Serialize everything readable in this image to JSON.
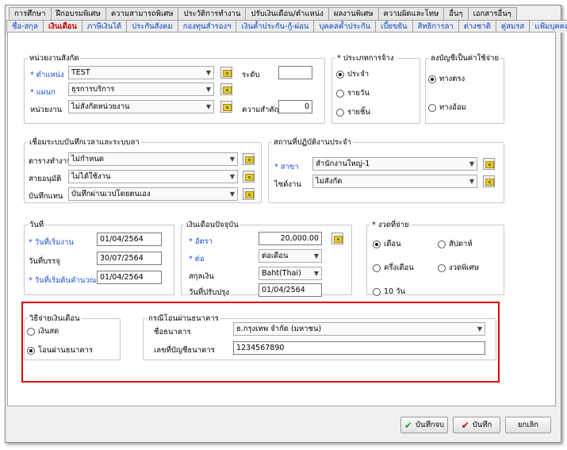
{
  "tabs_row1": [
    "การศึกษา",
    "ฝึกอบรมพิเศษ",
    "ความสามารถพิเศษ",
    "ประวัติการทำงาน",
    "ปรับเงินเดือน/ตำแหน่ง",
    "ผลงานพิเศษ",
    "ความผิดและโทษ",
    "อื่นๆ",
    "เอกสารอื่นๆ"
  ],
  "tabs_row2": [
    "ชื่อ-สกุล",
    "เงินเดือน",
    "ภาษีเงินได้",
    "ประกันสังคม",
    "กองทุนสำรองฯ",
    "เงินค้ำประกัน-กู้-ผ่อน",
    "บุคคลค้ำประกัน",
    "เบี้ยขยัน",
    "สิทธิการลา",
    "ต่างชาติ",
    "คู่สมรส",
    "แฟ้มบุคคล"
  ],
  "unit": {
    "legend": "หน่วยงานสังกัด",
    "position_label": "* ตำแหน่ง",
    "position_value": "TEST",
    "dept_label": "* แผนก",
    "dept_value": "ธุรการบริการ",
    "agency_label": "หน่วยงาน",
    "agency_value": "ไม่สังกัดหน่วยงาน",
    "level_label": "ระดับ",
    "level_value": "",
    "importance_label": "ความสำคัญ",
    "importance_value": "0"
  },
  "employ_type": {
    "legend": "* ประเภทการจ้าง",
    "options": [
      "ประจำ",
      "รายวัน",
      "รายชิ้น"
    ],
    "selected": "ประจำ"
  },
  "expense": {
    "legend": "ลงบัญชีเป็นค่าใช้จ่าย",
    "options": [
      "ทางตรง",
      "ทางอ้อม"
    ],
    "selected": "ทางตรง"
  },
  "time": {
    "legend": "เชื่อมระบบบันทึกเวลาและระบบลา",
    "schedule_label": "ตารางทำงาน",
    "schedule_value": "ไม่กำหนด",
    "approver_label": "สายอนุมัติ",
    "approver_value": "ไม่ได้ใช้งาน",
    "record_label": "บันทึกแทน",
    "record_value": "บันทึกผ่านเวปโดยตนเอง"
  },
  "workplace": {
    "legend": "สถานที่ปฏิบัติงานประจำ",
    "branch_label": "* สาขา",
    "branch_value": "สำนักงานใหญ่-1",
    "site_label": "ไซด์งาน",
    "site_value": "ไม่สังกัด"
  },
  "dates": {
    "legend": "วันที่",
    "start_label": "* วันที่เริ่มงาน",
    "start_value": "01/04/2564",
    "confirm_label": "วันที่บรรจุ",
    "confirm_value": "30/07/2564",
    "calc_label": "* วันที่เริ่มต้นคำนวณ",
    "calc_value": "01/04/2564"
  },
  "salary": {
    "legend": "เงินเดือนปัจจุบัน",
    "rate_label": "* อัตรา",
    "rate_value": "20,000.00",
    "per_label": "* ต่อ",
    "per_value": "ต่อเดือน",
    "currency_label": "สกุลเงิน",
    "currency_value": "Baht(Thai)",
    "adjust_label": "วันที่ปรับปรุง",
    "adjust_value": "01/04/2564"
  },
  "payroll": {
    "legend": "* งวดที่จ่าย",
    "options": [
      "เดือน",
      "สัปดาห์",
      "ครึ่งเดือน",
      "งวดพิเศษ",
      "10 วัน"
    ],
    "selected": "เดือน"
  },
  "pay_method": {
    "legend": "วิธีจ่ายเงินเดือน",
    "options": [
      "เงินสด",
      "โอนผ่านธนาคาร"
    ],
    "selected": "โอนผ่านธนาคาร"
  },
  "bank": {
    "legend": "กรณีโอนผ่านธนาคาร",
    "bank_label": "ชื่อธนาคาร",
    "bank_value": "ธ.กรุงเทพ จำกัด (มหาชน)",
    "account_label": "เลขที่บัญชีธนาคาร",
    "account_value": "1234567890"
  },
  "buttons": {
    "save_close": "บันทึกจบ",
    "save": "บันทึก",
    "cancel": "ยกเลิก"
  },
  "colors": {
    "label_blue": "#1a4fd8",
    "active_tab": "#c00000",
    "highlight": "#e00000",
    "check_green": "#2a9a2a"
  }
}
